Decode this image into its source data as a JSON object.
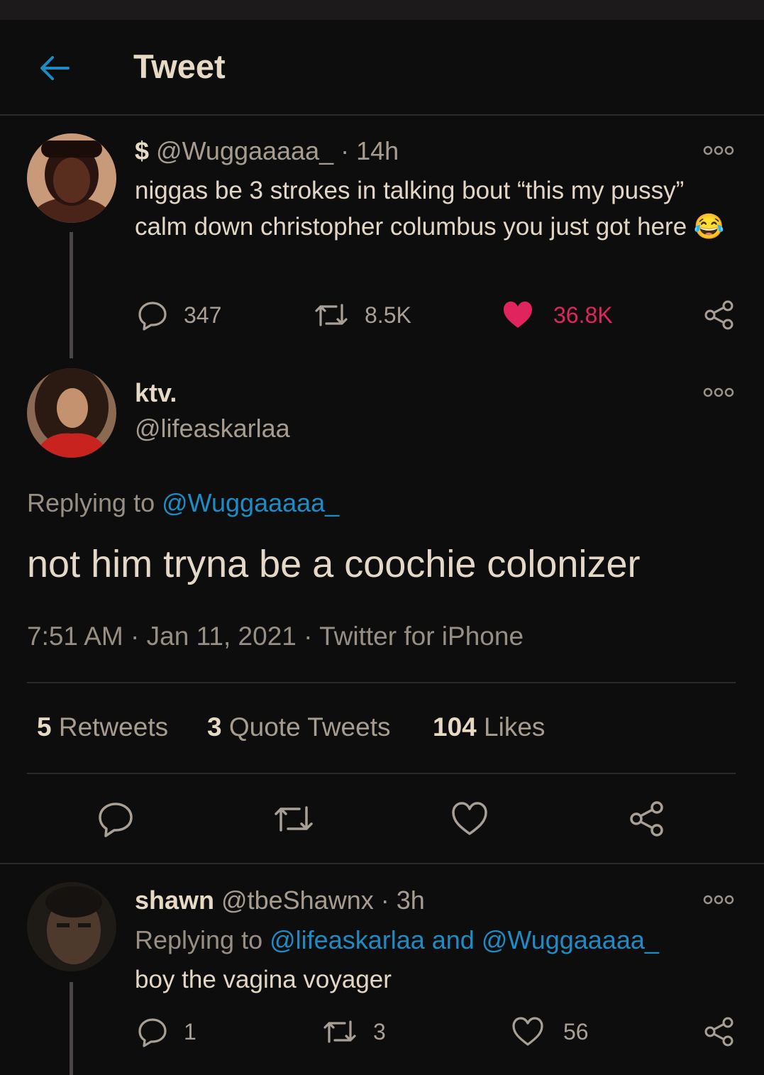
{
  "header": {
    "title": "Tweet"
  },
  "tweet1": {
    "name": "$",
    "handle": "@Wuggaaaaa_",
    "time": "· 14h",
    "text": "niggas be 3 strokes in talking bout “this my pussy” calm down christopher columbus you just got here",
    "emoji": "😂",
    "replies": "347",
    "retweets": "8.5K",
    "likes": "36.8K"
  },
  "main": {
    "name": "ktv.",
    "handle": "@lifeaskarlaa",
    "replying_label": "Replying to",
    "replying_to": "@Wuggaaaaa_",
    "text": "not him tryna be a coochie colonizer",
    "time": "7:51 AM",
    "date": "Jan 11, 2021",
    "source": "Twitter for iPhone",
    "stats": {
      "retweets_count": "5",
      "retweets_label": "Retweets",
      "quotes_count": "3",
      "quotes_label": "Quote Tweets",
      "likes_count": "104",
      "likes_label": "Likes"
    }
  },
  "reply": {
    "name": "shawn",
    "handle": "@tbeShawnx",
    "time": "· 3h",
    "replying_label": "Replying to",
    "replying_to": "@lifeaskarlaa and @Wuggaaaaa_",
    "text": "boy the vagina voyager",
    "replies": "1",
    "retweets": "3",
    "likes": "56"
  },
  "colors": {
    "background": "#0e0d0d",
    "link": "#1d8bc4",
    "like_active": "#e0245e"
  }
}
